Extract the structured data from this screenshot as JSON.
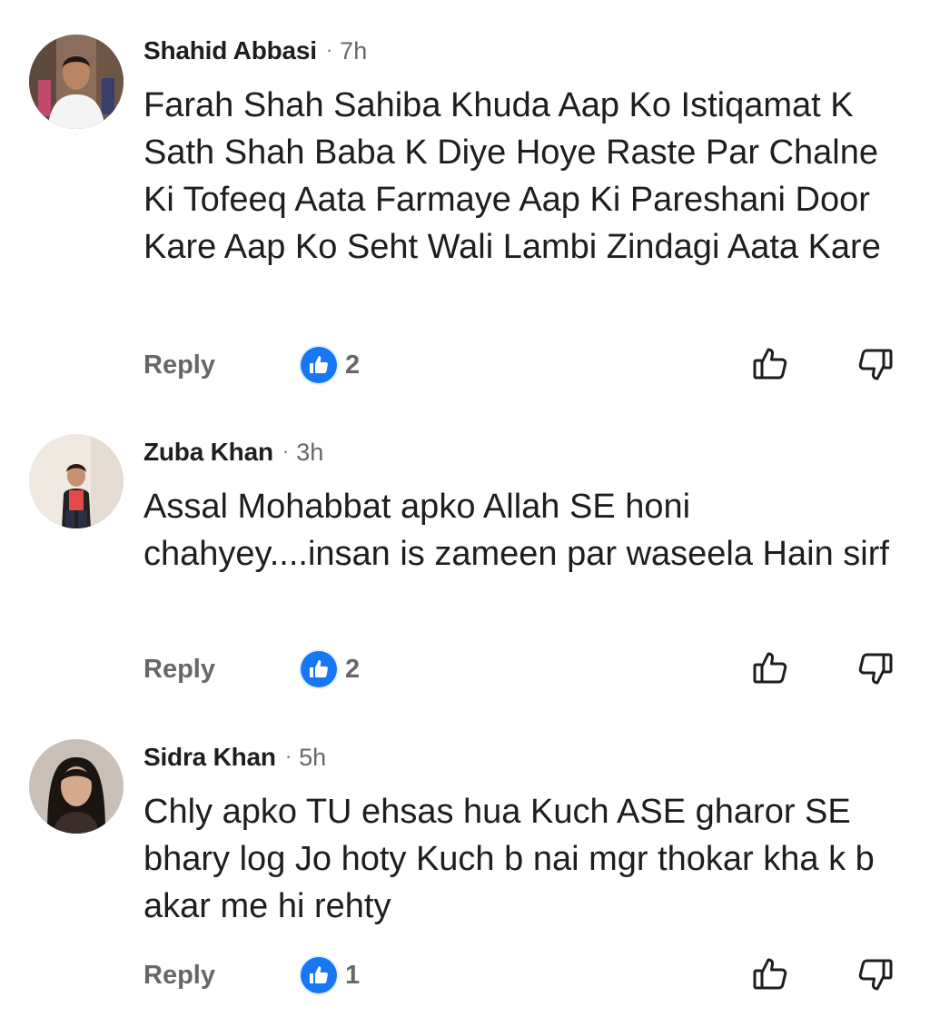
{
  "comments": [
    {
      "author": "Shahid Abbasi",
      "time": "7h",
      "text": "Farah Shah Sahiba Khuda Aap Ko Istiqamat K Sath Shah Baba K Diye Hoye Raste Par Chalne Ki Tofeeq Aata Farmaye Aap Ki Pareshani Door Kare Aap Ko Seht Wali Lambi Zindagi Aata Kare",
      "reply_label": "Reply",
      "reaction_count": "2"
    },
    {
      "author": "Zuba Khan",
      "time": "3h",
      "text": "Assal Mohabbat apko Allah SE honi chahyey....insan is zameen par waseela Hain sirf",
      "reply_label": "Reply",
      "reaction_count": "2"
    },
    {
      "author": "Sidra Khan",
      "time": "5h",
      "text": "Chly apko TU ehsas hua Kuch ASE gharor SE bhary log Jo hoty Kuch b nai mgr thokar kha k b akar me hi rehty",
      "reply_label": "Reply",
      "reaction_count": "1"
    }
  ],
  "separator": "·",
  "icons": {
    "reaction": "like-icon",
    "upvote": "thumbs-up-icon",
    "downvote": "thumbs-down-icon"
  },
  "colors": {
    "accent": "#1877f2",
    "text": "#1c1e21",
    "secondary": "#65676b"
  }
}
